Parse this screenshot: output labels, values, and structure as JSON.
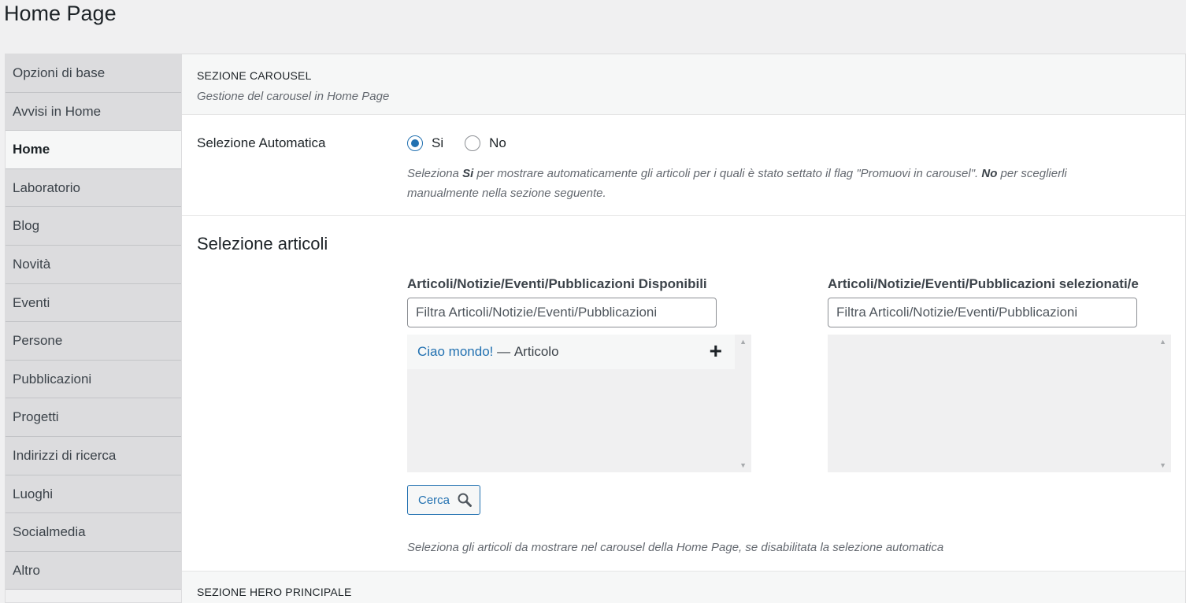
{
  "page": {
    "title": "Home Page"
  },
  "sidebar": {
    "items": [
      {
        "label": "Opzioni di base"
      },
      {
        "label": "Avvisi in Home"
      },
      {
        "label": "Home"
      },
      {
        "label": "Laboratorio"
      },
      {
        "label": "Blog"
      },
      {
        "label": "Novità"
      },
      {
        "label": "Eventi"
      },
      {
        "label": "Persone"
      },
      {
        "label": "Pubblicazioni"
      },
      {
        "label": "Progetti"
      },
      {
        "label": "Indirizzi di ricerca"
      },
      {
        "label": "Luoghi"
      },
      {
        "label": "Socialmedia"
      },
      {
        "label": "Altro"
      }
    ],
    "active": "Home"
  },
  "carousel": {
    "title": "SEZIONE CAROUSEL",
    "description": "Gestione del carousel in Home Page",
    "auto_label": "Selezione Automatica",
    "option_yes": "Si",
    "option_no": "No",
    "selected": "Si",
    "help_1": "Seleziona ",
    "help_si": "Si",
    "help_2": " per mostrare automaticamente gli articoli per i quali è stato settato il flag \"Promuovi in carousel\". ",
    "help_no": "No",
    "help_3": " per sceglierli manualmente nella sezione seguente."
  },
  "selection": {
    "title": "Selezione articoli",
    "available_header": "Articoli/Notizie/Eventi/Pubblicazioni Disponibili",
    "selected_header": "Articoli/Notizie/Eventi/Pubblicazioni selezionati/e",
    "filter_placeholder": "Filtra Articoli/Notizie/Eventi/Pubblicazioni",
    "available_items": [
      {
        "title": "Ciao mondo!",
        "separator": " — ",
        "type": "Articolo"
      }
    ],
    "search_button": "Cerca",
    "footer": "Seleziona gli articoli da mostrare nel carousel della Home Page, se disabilitata la selezione automatica"
  },
  "hero": {
    "title": "SEZIONE HERO PRINCIPALE"
  }
}
